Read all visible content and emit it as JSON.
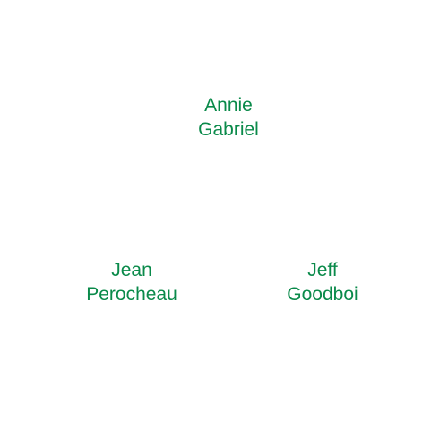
{
  "text_color": "#0a8a4a",
  "nodes": [
    {
      "first": "Annie",
      "last": "Gabriel"
    },
    {
      "first": "Jean",
      "last": "Perocheau"
    },
    {
      "first": "Jeff",
      "last": "Goodboi"
    }
  ]
}
